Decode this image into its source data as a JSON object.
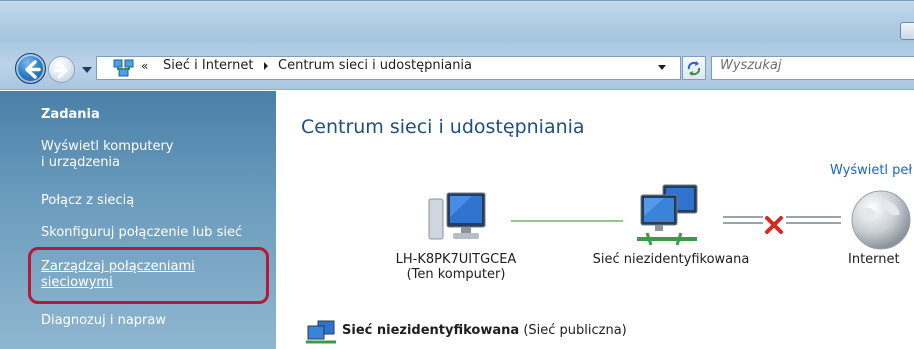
{
  "addressbar": {
    "overflow_chevron": "«",
    "path": [
      "Sieć i Internet",
      "Centrum sieci i udostępniania"
    ]
  },
  "search": {
    "placeholder": "Wyszukaj"
  },
  "sidebar": {
    "title": "Zadania",
    "items": [
      {
        "label_lines": [
          "Wyświetl komputery",
          "i urządzenia"
        ]
      },
      {
        "label_lines": [
          "Połącz z siecią"
        ]
      },
      {
        "label_lines": [
          "Skonfiguruj połączenie lub sieć"
        ]
      },
      {
        "label_lines": [
          "Zarządzaj połączeniami",
          "sieciowymi"
        ]
      },
      {
        "label_lines": [
          "Diagnozuj i napraw"
        ]
      }
    ]
  },
  "main": {
    "title": "Centrum sieci i udostępniania",
    "view_full_map": "Wyświetl peł",
    "nodes": [
      {
        "label": "LH-K8PK7UITGCEA",
        "sublabel": "(Ten komputer)"
      },
      {
        "label": "Sieć niezidentyfikowana"
      },
      {
        "label": "Internet"
      }
    ],
    "network_name": "Sieć niezidentyfikowana",
    "network_type": "(Sieć publiczna)"
  },
  "colors": {
    "sidebar_top": "#4a7fa7",
    "highlight_border": "#b6183a",
    "title_blue": "#1f4f7d",
    "link_blue": "#1a64c8",
    "ok_line": "#8acc7a",
    "error_red": "#d42a1f"
  },
  "icons": {
    "back": "back-arrow-icon",
    "forward": "forward-arrow-icon",
    "network_folder": "network-folder-icon",
    "refresh": "refresh-icon",
    "computer": "computer-icon",
    "network": "network-icon",
    "error": "red-x-icon",
    "internet": "globe-icon"
  }
}
